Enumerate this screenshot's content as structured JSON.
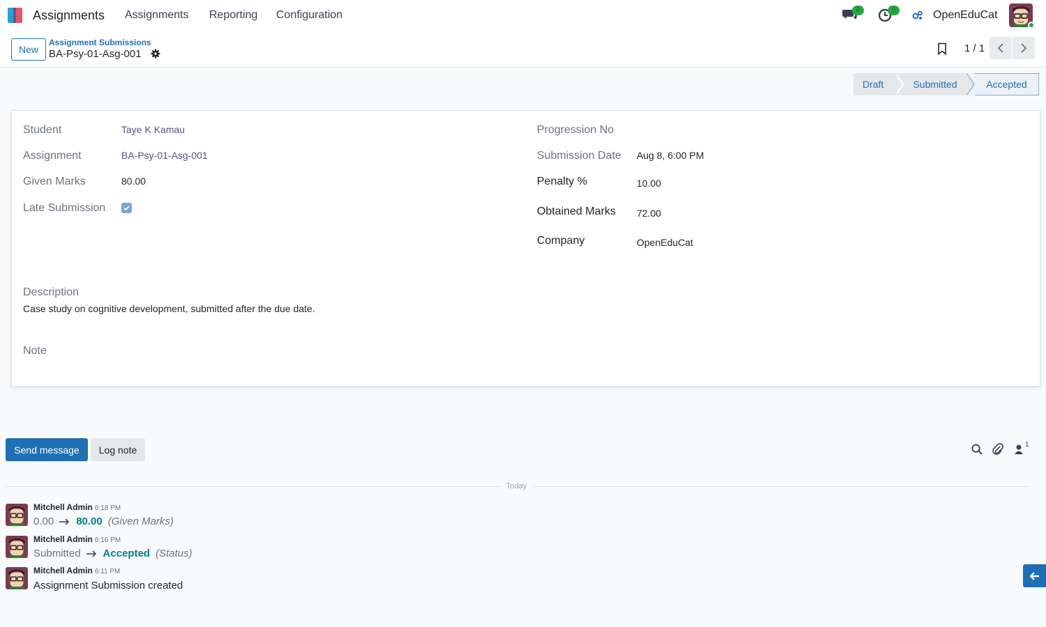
{
  "navbar": {
    "app_name": "Assignments",
    "menu": [
      "Assignments",
      "Reporting",
      "Configuration"
    ],
    "messages_badge": "8",
    "activities_badge": "6",
    "company": "OpenEduCat"
  },
  "control": {
    "new_label": "New",
    "breadcrumb_parent": "Assignment Submissions",
    "breadcrumb_current": "BA-Psy-01-Asg-001",
    "pager": "1 / 1"
  },
  "statusbar": {
    "stages": [
      "Draft",
      "Submitted",
      "Accepted"
    ],
    "active": "Accepted"
  },
  "form": {
    "student_label": "Student",
    "student": "Taye K Kamau",
    "assignment_label": "Assignment",
    "assignment": "BA-Psy-01-Asg-001",
    "given_marks_label": "Given Marks",
    "given_marks": "80.00",
    "late_submission_label": "Late Submission",
    "late_submission": true,
    "progression_label": "Progression No",
    "submission_date_label": "Submission Date",
    "submission_date": "Aug 8, 6:00 PM",
    "penalty_label": "Penalty %",
    "penalty": "10.00",
    "obtained_marks_label": "Obtained Marks",
    "obtained_marks": "72.00",
    "company_label": "Company",
    "company": "OpenEduCat",
    "description_label": "Description",
    "description": "Case study on cognitive development, submitted after the due date.",
    "note_label": "Note"
  },
  "chatter": {
    "send_message": "Send message",
    "log_note": "Log note",
    "followers_count": "1",
    "separator": "Today",
    "messages": [
      {
        "author": "Mitchell Admin",
        "time": "6:18 PM",
        "old": "0.00",
        "new": "80.00",
        "field": "(Given Marks)"
      },
      {
        "author": "Mitchell Admin",
        "time": "6:16 PM",
        "old": "Submitted",
        "new": "Accepted",
        "field": "(Status)"
      },
      {
        "author": "Mitchell Admin",
        "time": "6:11 PM",
        "text": "Assignment Submission created"
      }
    ]
  },
  "colors": {
    "primary": "#1f6fb5",
    "tracking_new": "#017e84",
    "link": "#5b4f82",
    "badge": "#28a745"
  }
}
